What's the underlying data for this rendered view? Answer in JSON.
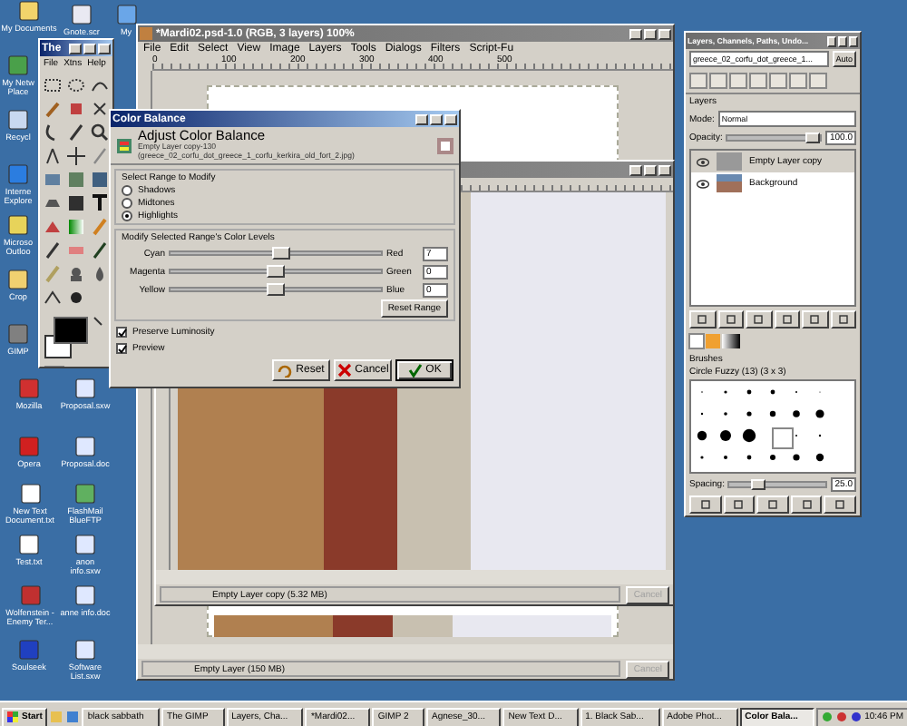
{
  "desktop_icons": [
    {
      "label": "My Documents"
    },
    {
      "label": "Gnote.scr"
    },
    {
      "label": "My"
    },
    {
      "label": "My Netw Place"
    },
    {
      "label": "Recycl"
    },
    {
      "label": "Interne Explore"
    },
    {
      "label": "Microso Outloo"
    },
    {
      "label": "Crop"
    },
    {
      "label": "GIMP"
    },
    {
      "label": "Mozilla"
    },
    {
      "label": "Proposal.sxw"
    },
    {
      "label": "Opera"
    },
    {
      "label": "Proposal.doc"
    },
    {
      "label": "New Text Document.txt"
    },
    {
      "label": "FlashMail BlueFTP"
    },
    {
      "label": "Test.txt"
    },
    {
      "label": "anon info.sxw"
    },
    {
      "label": "Wolfenstein - Enemy Ter..."
    },
    {
      "label": "anne info.doc"
    },
    {
      "label": "Soulseek"
    },
    {
      "label": "Software List.sxw"
    }
  ],
  "toolbox": {
    "title": "The",
    "menu": [
      "File",
      "Xtns",
      "Help"
    ]
  },
  "image_window": {
    "title": "*Mardi02.psd-1.0 (RGB, 3 layers) 100%",
    "menu": [
      "File",
      "Edit",
      "Select",
      "View",
      "Image",
      "Layers",
      "Tools",
      "Dialogs",
      "Filters",
      "Script-Fu"
    ],
    "ruler_labels": [
      "0",
      "100",
      "200",
      "300",
      "400",
      "500"
    ],
    "status": "Empty Layer (150 MB)",
    "cancel": {
      "label": "Cancel",
      "disabled": true
    }
  },
  "front_window": {
    "status": "Empty Layer copy (5.32 MB)",
    "cancel": {
      "label": "Cancel",
      "disabled": true
    }
  },
  "color_balance": {
    "title": "Color Balance",
    "heading": "Adjust Color Balance",
    "subtitle": "Empty Layer copy-130 (greece_02_corfu_dot_greece_1_corfu_kerkira_old_fort_2.jpg)",
    "range_frame": "Select Range to Modify",
    "ranges": [
      {
        "label": "Shadows",
        "selected": false
      },
      {
        "label": "Midtones",
        "selected": false
      },
      {
        "label": "Highlights",
        "selected": true
      }
    ],
    "levels_frame": "Modify Selected Range's Color Levels",
    "sliders": [
      {
        "left": "Cyan",
        "right": "Red",
        "level": 0.53,
        "value": "7"
      },
      {
        "left": "Magenta",
        "right": "Green",
        "level": 0.5,
        "value": "0"
      },
      {
        "left": "Yellow",
        "right": "Blue",
        "level": 0.5,
        "value": "0"
      }
    ],
    "reset_range": "Reset Range",
    "options": [
      {
        "label": "Preserve Luminosity",
        "checked": true
      },
      {
        "label": "Preview",
        "checked": true
      }
    ],
    "buttons": [
      {
        "label": "Reset",
        "kind": "reset"
      },
      {
        "label": "Cancel",
        "kind": "cancel"
      },
      {
        "label": "OK",
        "kind": "ok"
      }
    ]
  },
  "layers_dialog": {
    "title": "Layers, Channels, Paths, Undo...",
    "image": "greece_02_corfu_dot_greece_1...",
    "auto": "Auto",
    "layers_label": "Layers",
    "mode_label": "Mode:",
    "mode": "Normal",
    "opacity_label": "Opacity:",
    "opacity": {
      "value": "100.0",
      "level": 1
    },
    "layers": [
      {
        "name": "Empty Layer copy",
        "selected": true,
        "visible": true
      },
      {
        "name": "Background",
        "selected": false,
        "visible": true
      }
    ],
    "brushes_label": "Brushes",
    "brush_name": "Circle Fuzzy (13) (3 x 3)",
    "spacing_label": "Spacing:",
    "spacing": {
      "value": "25.0",
      "level": 0.25
    }
  },
  "taskbar": {
    "start": "Start",
    "tasks": [
      {
        "label": "black sabbath",
        "selected": false
      },
      {
        "label": "The GIMP",
        "selected": false
      },
      {
        "label": "Layers, Cha...",
        "selected": false
      },
      {
        "label": "*Mardi02...",
        "selected": false
      },
      {
        "label": "GIMP 2",
        "selected": false
      },
      {
        "label": "Agnese_30...",
        "selected": false
      },
      {
        "label": "New Text D...",
        "selected": false
      },
      {
        "label": "1. Black Sab...",
        "selected": false
      },
      {
        "label": "Adobe Phot...",
        "selected": false
      },
      {
        "label": "Color Bala...",
        "selected": true
      }
    ],
    "clock": "10:46 PM"
  }
}
